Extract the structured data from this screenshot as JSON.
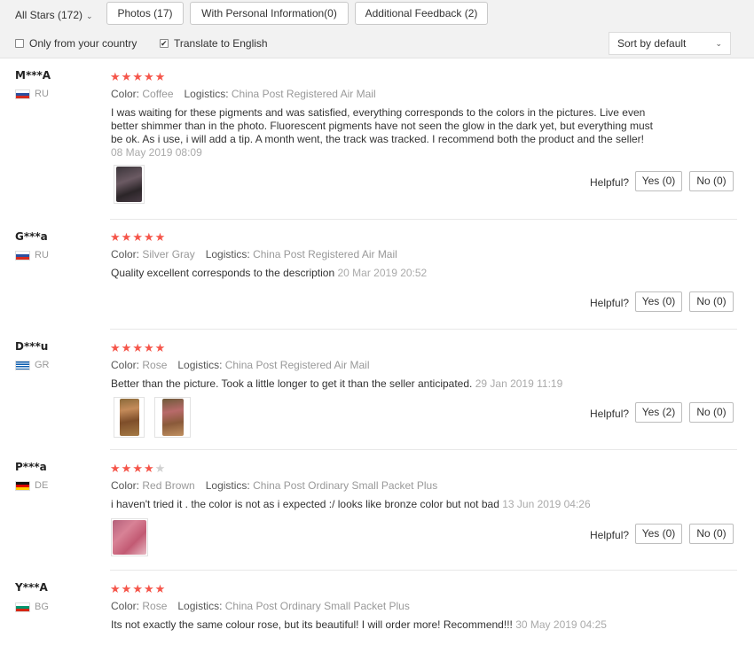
{
  "toolbar": {
    "star_filter": "All Stars (172)",
    "photos_label": "Photos (17)",
    "personal_info_label": "With Personal Information(0)",
    "additional_feedback_label": "Additional Feedback (2)",
    "only_country_label": "Only from your country",
    "translate_label": "Translate to English",
    "translate_checked": true,
    "sort_label": "Sort by default"
  },
  "labels": {
    "color": "Color:",
    "logistics": "Logistics:",
    "helpful": "Helpful?"
  },
  "reviews": [
    {
      "user": "M***A",
      "country": "RU",
      "stars": 5,
      "color": "Coffee",
      "logistics": "China Post Registered Air Mail",
      "text": "I was waiting for these pigments and was satisfied, everything corresponds to the colors in the pictures. Live even better shimmer than in the photo. Fluorescent pigments have not seen the glow in the dark yet, but everything must be ok. As i use, i will add a tip. A month went, the track was tracked. I recommend both the product and the seller!",
      "date": "08 May 2019 08:09",
      "yes": "Yes (0)",
      "no": "No (0)"
    },
    {
      "user": "G***a",
      "country": "RU",
      "stars": 5,
      "color": "Silver Gray",
      "logistics": "China Post Registered Air Mail",
      "text": "Quality excellent corresponds to the description",
      "date": "20 Mar 2019 20:52",
      "yes": "Yes (0)",
      "no": "No (0)"
    },
    {
      "user": "D***u",
      "country": "GR",
      "stars": 5,
      "color": "Rose",
      "logistics": "China Post Registered Air Mail",
      "text": "Better than the picture. Took a little longer to get it than the seller anticipated.",
      "date": "29 Jan 2019 11:19",
      "yes": "Yes (2)",
      "no": "No (0)"
    },
    {
      "user": "P***a",
      "country": "DE",
      "stars": 4,
      "color": "Red Brown",
      "logistics": "China Post Ordinary Small Packet Plus",
      "text": "i haven't tried it . the color is not as i expected :/ looks like bronze color but not bad",
      "date": "13 Jun 2019 04:26",
      "yes": "Yes (0)",
      "no": "No (0)"
    },
    {
      "user": "Y***A",
      "country": "BG",
      "stars": 5,
      "color": "Rose",
      "logistics": "China Post Ordinary Small Packet Plus",
      "text": "Its not exactly the same colour rose, but its beautiful! I will order more! Recommend!!!",
      "date": "30 May 2019 04:25",
      "yes": "",
      "no": ""
    }
  ],
  "icons": {
    "dropdown": "chevron-down-icon",
    "star": "star-icon",
    "checkbox": "checkbox-icon",
    "flag": "flag-icon"
  },
  "colors": {
    "star": "#f5554a",
    "star_empty": "#d0d0d0",
    "muted_text": "#999999"
  }
}
